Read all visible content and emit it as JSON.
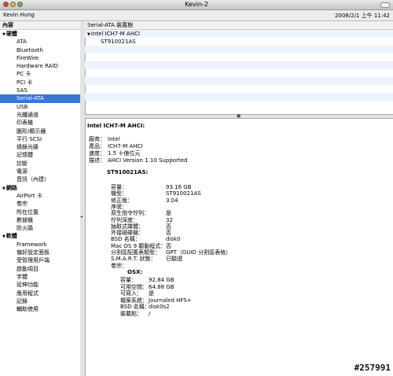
{
  "window": {
    "title": "Kevin-2",
    "user": "Kevin Hung",
    "timestamp": "2008/2/1 上午 11:42"
  },
  "sidebar": {
    "header": "內容",
    "groups": [
      {
        "label": "硬體",
        "items": [
          "ATA",
          "Bluetooth",
          "FireWire",
          "Hardware RAID",
          "PC 卡",
          "PCI 卡",
          "SAS",
          "Serial-ATA",
          "USB",
          "光纖通道",
          "印表機",
          "圖形/顯示器",
          "平行 SCSI",
          "燒錄光碟",
          "記憶體",
          "診斷",
          "電源",
          "音訊（內建）"
        ]
      },
      {
        "label": "網路",
        "items": [
          "AirPort 卡",
          "卷宗",
          "所在位置",
          "數據機",
          "防火牆"
        ]
      },
      {
        "label": "軟體",
        "items": [
          "Framework",
          "偏好設定面板",
          "受管理用戶端",
          "啟動項目",
          "字體",
          "延伸功能",
          "應用程式",
          "記錄",
          "輔助使用"
        ]
      }
    ],
    "selected": "Serial-ATA"
  },
  "top_pane": {
    "header": "Serial-ATA 裝置樹",
    "controller": "Intel ICH7-M AHCI",
    "device": "ST910021AS"
  },
  "detail": {
    "title": "Intel ICH7-M AHCI:",
    "controller_fields": [
      {
        "k": "廠商：",
        "v": "Intel"
      },
      {
        "k": "產品：",
        "v": "ICH7-M AHCI"
      },
      {
        "k": "速度：",
        "v": "1.5 十億位元"
      },
      {
        "k": "描述：",
        "v": "AHCI Version 1.10 Supported"
      }
    ],
    "device_title": "ST910021AS:",
    "device_fields": [
      {
        "k": "容量：",
        "v": "93.16 GB"
      },
      {
        "k": "機型：",
        "v": "ST910021AS"
      },
      {
        "k": "修正版：",
        "v": "3.04"
      },
      {
        "k": "序號：",
        "v": ""
      },
      {
        "k": "原生指令佇列：",
        "v": "是"
      },
      {
        "k": "佇列深度：",
        "v": "32"
      },
      {
        "k": "抽取式媒體：",
        "v": "否"
      },
      {
        "k": "外接磁碟機：",
        "v": "否"
      },
      {
        "k": "BSD 名稱：",
        "v": "disk0"
      },
      {
        "k": "Mac OS 9 驅動程式：",
        "v": "否"
      },
      {
        "k": "分割區配置表類型：",
        "v": "GPT（GUID 分割區表格）"
      },
      {
        "k": "S.M.A.R.T. 狀態：",
        "v": "已驗證"
      },
      {
        "k": "卷宗：",
        "v": ""
      }
    ],
    "volume_title": "OSX:",
    "volume_fields": [
      {
        "k": "容量：",
        "v": "92.84 GB"
      },
      {
        "k": "可用空間：",
        "v": "64.88 GB"
      },
      {
        "k": "可寫入：",
        "v": "是"
      },
      {
        "k": "檔案系統：",
        "v": "Journaled HFS+"
      },
      {
        "k": "BSD 名稱：",
        "v": "disk0s2"
      },
      {
        "k": "裝載點：",
        "v": "/"
      }
    ]
  },
  "watermark": "#257991"
}
